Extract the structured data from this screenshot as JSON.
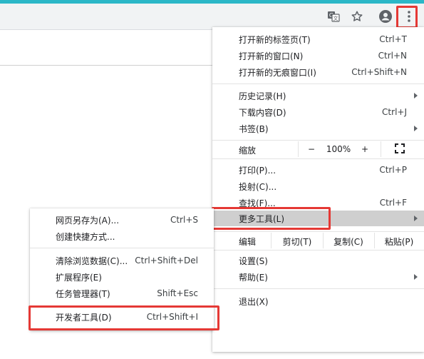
{
  "toolbar": {
    "icons": [
      "translate-icon",
      "bookmark-star-icon",
      "profile-icon",
      "menu-more-icon"
    ]
  },
  "main_menu": {
    "group1": [
      {
        "label": "打开新的标签页(T)",
        "shortcut": "Ctrl+T"
      },
      {
        "label": "打开新的窗口(N)",
        "shortcut": "Ctrl+N"
      },
      {
        "label": "打开新的无痕窗口(I)",
        "shortcut": "Ctrl+Shift+N"
      }
    ],
    "group2": [
      {
        "label": "历史记录(H)",
        "submenu": true
      },
      {
        "label": "下载内容(D)",
        "shortcut": "Ctrl+J"
      },
      {
        "label": "书签(B)",
        "submenu": true
      }
    ],
    "zoom": {
      "label": "缩放",
      "minus": "−",
      "value": "100%",
      "plus": "+"
    },
    "group3": [
      {
        "label": "打印(P)...",
        "shortcut": "Ctrl+P"
      },
      {
        "label": "投射(C)..."
      },
      {
        "label": "查找(F)...",
        "shortcut": "Ctrl+F"
      },
      {
        "label": "更多工具(L)",
        "submenu": true
      }
    ],
    "edit": {
      "label": "编辑",
      "cut": "剪切(T)",
      "copy": "复制(C)",
      "paste": "粘贴(P)"
    },
    "group4": [
      {
        "label": "设置(S)"
      },
      {
        "label": "帮助(E)",
        "submenu": true
      }
    ],
    "exit": {
      "label": "退出(X)"
    }
  },
  "sub_menu": {
    "group1": [
      {
        "label": "网页另存为(A)...",
        "shortcut": "Ctrl+S"
      },
      {
        "label": "创建快捷方式..."
      }
    ],
    "group2": [
      {
        "label": "清除浏览数据(C)...",
        "shortcut": "Ctrl+Shift+Del"
      },
      {
        "label": "扩展程序(E)"
      },
      {
        "label": "任务管理器(T)",
        "shortcut": "Shift+Esc"
      }
    ],
    "group3": [
      {
        "label": "开发者工具(D)",
        "shortcut": "Ctrl+Shift+I"
      }
    ]
  },
  "colors": {
    "highlight": "#e53935",
    "accent_bar": "#2bb7c7",
    "hover": "#cfcfcf"
  }
}
